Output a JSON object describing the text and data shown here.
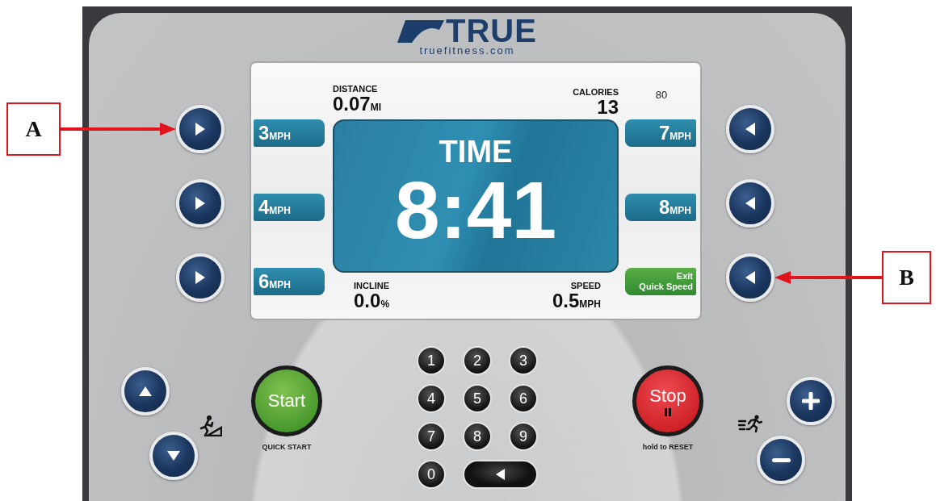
{
  "logo": {
    "brand": "TRUE",
    "website": "truefitness.com"
  },
  "display": {
    "top_stats": [
      {
        "label": "DISTANCE",
        "value": "0.07",
        "unit": "MI"
      },
      {
        "label": "CALORIES",
        "value": "13"
      }
    ],
    "side_reading": "80",
    "timer": {
      "label": "TIME",
      "value": "8:41"
    },
    "bottom_stats": [
      {
        "label": "INCLINE",
        "value": "0.0",
        "unit": "%"
      },
      {
        "label": "SPEED",
        "value": "0.5",
        "unit": "MPH"
      }
    ]
  },
  "quick_speed": {
    "left": [
      {
        "kind": "speed",
        "value": "3",
        "unit": "MPH",
        "callout": "A"
      },
      {
        "kind": "speed",
        "value": "4",
        "unit": "MPH"
      },
      {
        "kind": "speed",
        "value": "6",
        "unit": "MPH"
      }
    ],
    "right": [
      {
        "kind": "speed",
        "value": "7",
        "unit": "MPH"
      },
      {
        "kind": "speed",
        "value": "8",
        "unit": "MPH"
      },
      {
        "kind": "exit",
        "lines": [
          "Exit",
          "Quick Speed"
        ],
        "callout": "B"
      }
    ]
  },
  "start": {
    "label": "Start",
    "caption": "QUICK START"
  },
  "keypad": [
    "1",
    "2",
    "3",
    "4",
    "5",
    "6",
    "7",
    "8",
    "9",
    "0"
  ],
  "stop": {
    "label": "Stop",
    "caption": "hold to RESET"
  }
}
